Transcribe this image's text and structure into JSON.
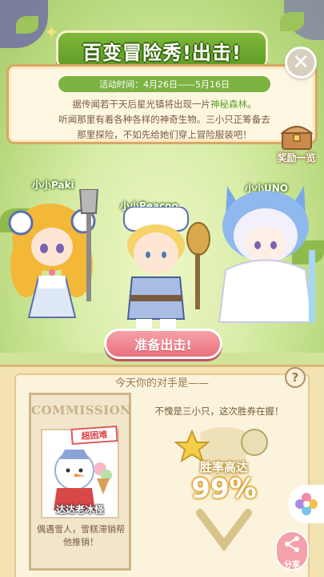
{
  "banner": {
    "title": "百变冒险秀!出击!"
  },
  "event": {
    "date": "活动时间：4月26日——5月16日",
    "desc_line1_a": "据传闻若干天后星光镇将出现一片",
    "desc_line1_hl": "神秘森林",
    "desc_line1_b": "。",
    "desc_line2": "听闻那里有着各种各样的神奇生物。三小只正筹备去",
    "desc_line3": "那里探险，不如先给她们穿上冒险服装吧！"
  },
  "close_label": "✕",
  "reward": {
    "label": "奖励一览"
  },
  "characters": [
    {
      "name": "小小Paki"
    },
    {
      "name": "小小Peacoo"
    },
    {
      "name": "小小UNO"
    }
  ],
  "ready_button": "准备出击!",
  "opponent": {
    "title": "今天你的对手是——",
    "help": "?",
    "commission_title": "COMMISSION",
    "difficulty": "超困难",
    "enemy_name": "达达老冰怪",
    "enemy_desc": "偶遇雪人，雪糕滞销帮他推销！",
    "win_text": "不愧是三小只，这次胜券在握！",
    "win_label": "胜率高达",
    "win_rate": "99%"
  },
  "share_label": "分享",
  "colors": {
    "accent_green": "#7cb343",
    "button_pink": "#e8727d",
    "panel_border": "#d9a766"
  }
}
